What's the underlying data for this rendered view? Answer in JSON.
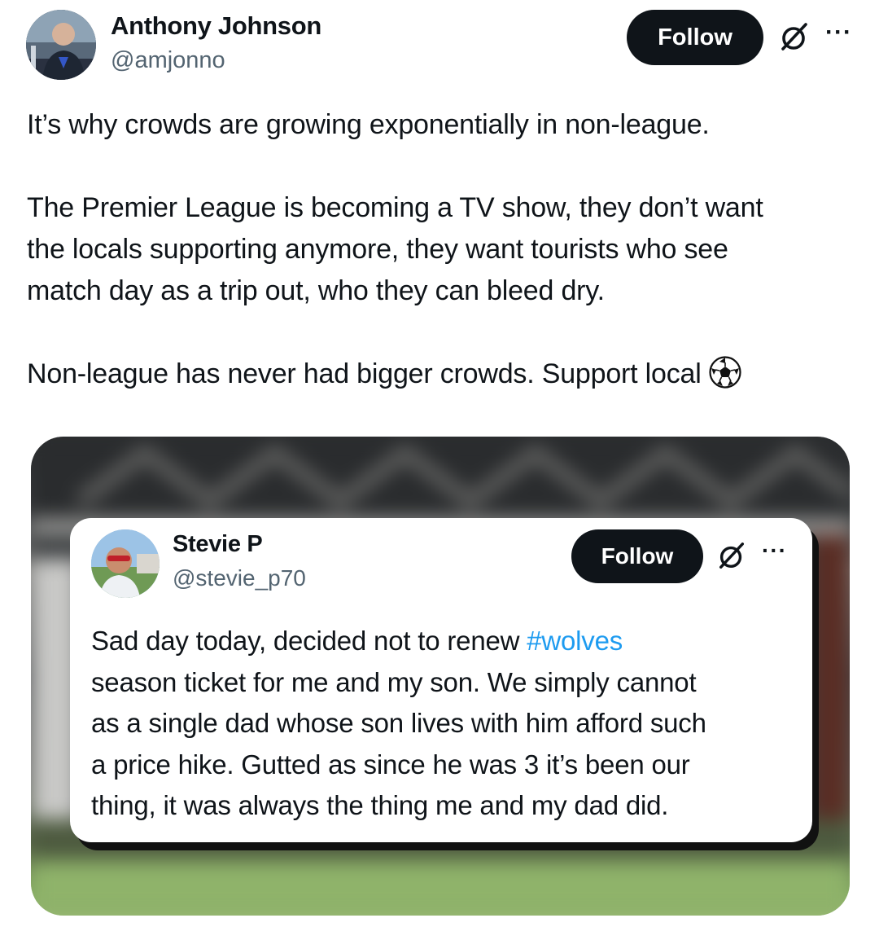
{
  "post": {
    "author": {
      "name": "Anthony Johnson",
      "handle": "@amjonno",
      "follow_label": "Follow",
      "more_label": "···"
    },
    "text": {
      "line1": "It’s why crowds are growing exponentially in non-league.",
      "para2_lines": [
        "The Premier League is becoming a TV show, they don’t want",
        "the locals supporting anymore, they want tourists who see",
        "match day as a trip out, who they can bleed dry."
      ],
      "line3": "Non-league has never had bigger crowds. Support local",
      "line3_emoji": "soccer-ball-icon"
    },
    "quoted": {
      "author": {
        "name": "Stevie P",
        "handle": "@stevie_p70",
        "follow_label": "Follow",
        "more_label": "···"
      },
      "lines": [
        {
          "before": "Sad day today, decided not to renew ",
          "hashtag": "#wolves"
        },
        {
          "text": "season ticket for me and my son. We simply cannot"
        },
        {
          "text": "as a single dad whose son lives with him afford such"
        },
        {
          "text": "a price hike. Gutted as since he was 3 it’s been our"
        },
        {
          "text": "thing, it was always the thing me and my dad did."
        }
      ]
    },
    "icons": [
      "grok-icon",
      "more-icon",
      "soccer-ball-icon",
      "avatar"
    ],
    "colors": {
      "text": "#0f1419",
      "secondary": "#536471",
      "button": "#0f1419",
      "hashtag": "#1d9bf0"
    }
  }
}
